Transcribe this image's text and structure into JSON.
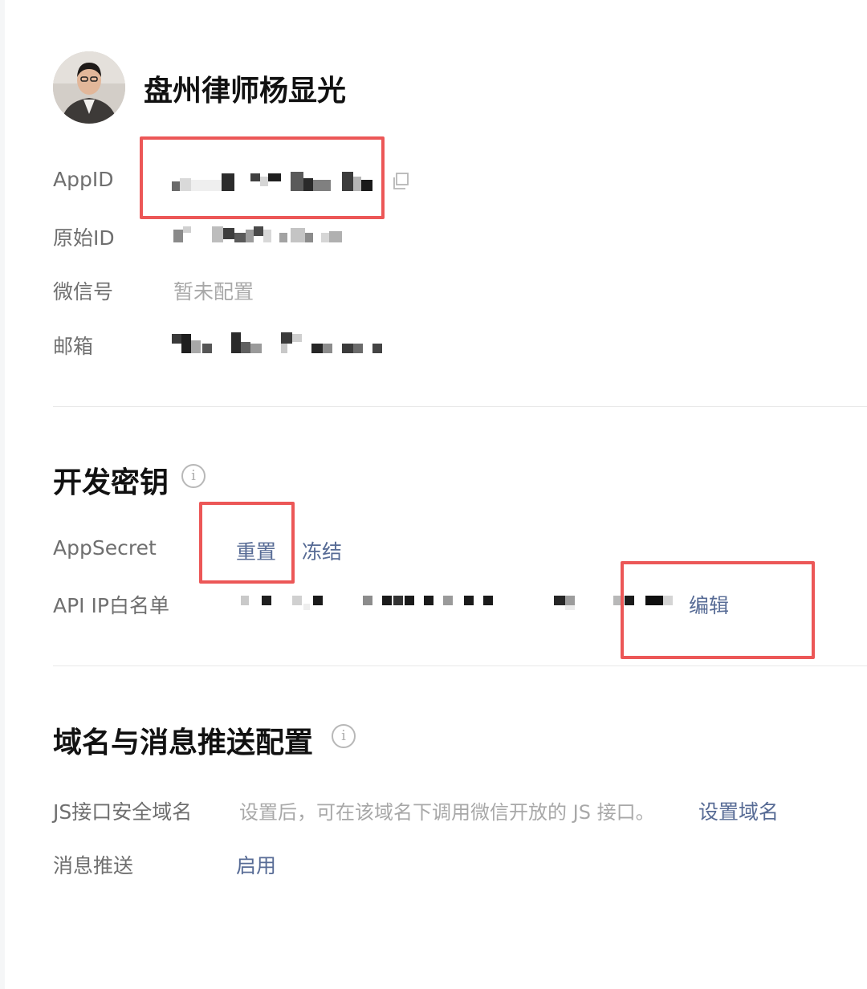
{
  "account": {
    "name": "盘州律师杨显光"
  },
  "basic_info": {
    "appid_label": "AppID",
    "original_id_label": "原始ID",
    "wechat_id_label": "微信号",
    "wechat_id_value": "暂未配置",
    "email_label": "邮箱"
  },
  "dev_keys": {
    "title": "开发密钥",
    "appsecret_label": "AppSecret",
    "reset_label": "重置",
    "freeze_label": "冻结",
    "ip_whitelist_label": "API IP白名单",
    "edit_label": "编辑"
  },
  "domain_section": {
    "title": "域名与消息推送配置",
    "js_domain_label": "JS接口安全域名",
    "js_domain_desc": "设置后，可在该域名下调用微信开放的 JS 接口。",
    "set_domain_label": "设置域名",
    "push_label": "消息推送",
    "enable_label": "启用"
  },
  "colors": {
    "link": "#576b95",
    "highlight": "#ec5757"
  },
  "icons": {
    "copy": "copy-icon",
    "info": "info-icon"
  }
}
